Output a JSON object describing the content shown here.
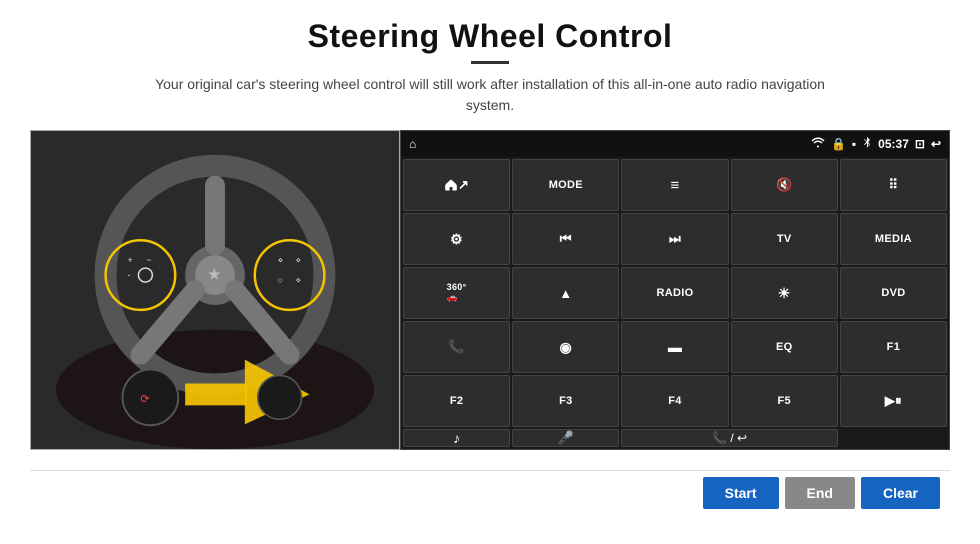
{
  "header": {
    "title": "Steering Wheel Control",
    "subtitle": "Your original car's steering wheel control will still work after installation of this all-in-one auto radio navigation system."
  },
  "status_bar": {
    "time": "05:37",
    "home_icon": "⌂",
    "wifi_icon": "wifi",
    "lock_icon": "🔒",
    "sd_icon": "sd",
    "bluetooth_icon": "bt",
    "back_icon": "↩",
    "window_icon": "⊡"
  },
  "buttons": [
    [
      {
        "label": "↗",
        "icon": true
      },
      {
        "label": "MODE"
      },
      {
        "label": "≡",
        "icon": true
      },
      {
        "label": "🔇",
        "icon": true
      },
      {
        "label": "⠿",
        "icon": true
      }
    ],
    [
      {
        "label": "⚙",
        "icon": true
      },
      {
        "label": "⏮",
        "icon": true
      },
      {
        "label": "⏭",
        "icon": true
      },
      {
        "label": "TV"
      },
      {
        "label": "MEDIA"
      }
    ],
    [
      {
        "label": "360°",
        "small": true
      },
      {
        "label": "▲",
        "icon": true
      },
      {
        "label": "RADIO"
      },
      {
        "label": "☀",
        "icon": true
      },
      {
        "label": "DVD"
      }
    ],
    [
      {
        "label": "📞",
        "icon": true
      },
      {
        "label": "◉",
        "icon": true
      },
      {
        "label": "▬",
        "icon": true
      },
      {
        "label": "EQ"
      },
      {
        "label": "F1"
      }
    ],
    [
      {
        "label": "F2"
      },
      {
        "label": "F3"
      },
      {
        "label": "F4"
      },
      {
        "label": "F5"
      },
      {
        "label": "▶⏸",
        "icon": true
      }
    ]
  ],
  "last_row": [
    {
      "label": "♪",
      "icon": true
    },
    {
      "label": "🎤",
      "icon": true
    },
    {
      "label": "📞/↩",
      "icon": true
    }
  ],
  "bottom_bar": {
    "start_label": "Start",
    "end_label": "End",
    "clear_label": "Clear"
  }
}
